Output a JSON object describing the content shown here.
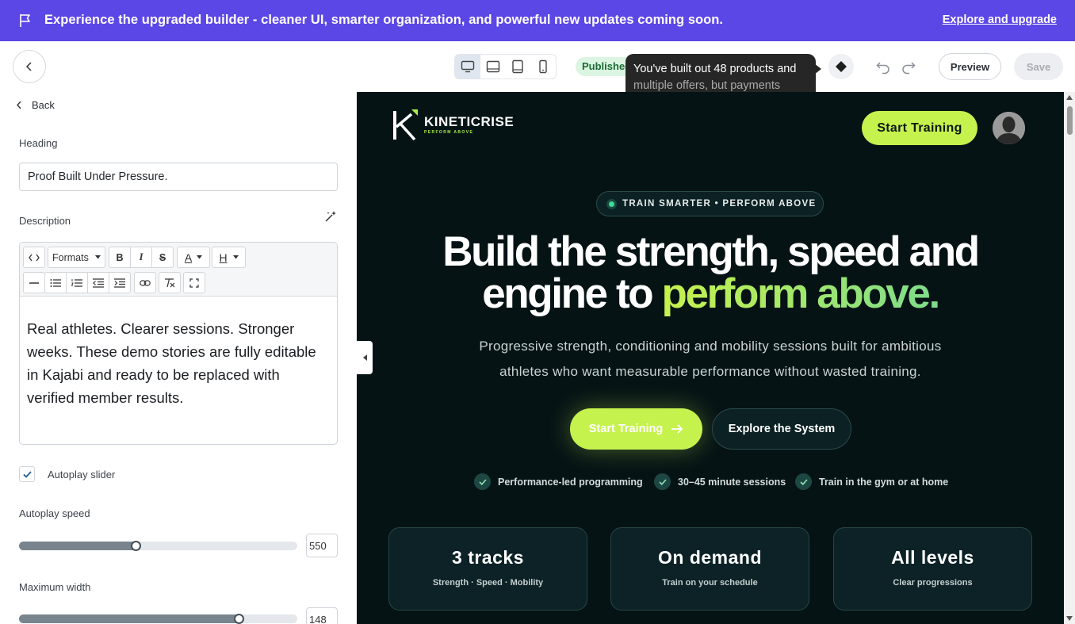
{
  "banner": {
    "text": "Experience the upgraded builder - cleaner UI, smarter organization, and powerful new updates coming soon.",
    "link": "Explore and upgrade"
  },
  "toolbar": {
    "status": "Published",
    "tooltip_line1": "You've built out 48 products and",
    "tooltip_line2": "multiple offers, but payments",
    "preview_label": "Preview",
    "save_label": "Save"
  },
  "panel": {
    "back_label": "Back",
    "heading_label": "Heading",
    "heading_value": "Proof Built Under Pressure.",
    "description_label": "Description",
    "formats_label": "Formats",
    "description_text": "Real athletes. Clearer sessions. Stronger weeks. These demo stories are fully editable in Kajabi and ready to be replaced with verified member results.",
    "autoplay_label": "Autoplay slider",
    "autoplay_checked": true,
    "autoplay_speed_label": "Autoplay speed",
    "autoplay_speed_value": "550",
    "autoplay_speed_fraction": 0.42,
    "max_width_label": "Maximum width",
    "max_width_value": "148",
    "max_width_fraction": 0.79
  },
  "site": {
    "brand": "KINETICRISE",
    "tagline": "PERFORM ABOVE",
    "header_cta": "Start Training",
    "eyebrow": "TRAIN SMARTER • PERFORM ABOVE",
    "title_line1": "Build the strength, speed and",
    "title_line2_start": "engine to ",
    "title_highlight": "perform above.",
    "subtitle_line1": "Progressive strength, conditioning and mobility sessions built for ambitious",
    "subtitle_line2": "athletes who want measurable performance without wasted training.",
    "primary_cta": "Start Training",
    "secondary_cta": "Explore the System",
    "features": [
      "Performance-led programming",
      "30–45 minute sessions",
      "Train in the gym or at home"
    ],
    "stats": [
      {
        "title": "3 tracks",
        "sub": "Strength · Speed · Mobility"
      },
      {
        "title": "On demand",
        "sub": "Train on your schedule"
      },
      {
        "title": "All levels",
        "sub": "Clear progressions"
      }
    ]
  },
  "colors": {
    "banner": "#5b47e6",
    "accent": "#c6f24e",
    "canvas_bg": "#061315"
  }
}
